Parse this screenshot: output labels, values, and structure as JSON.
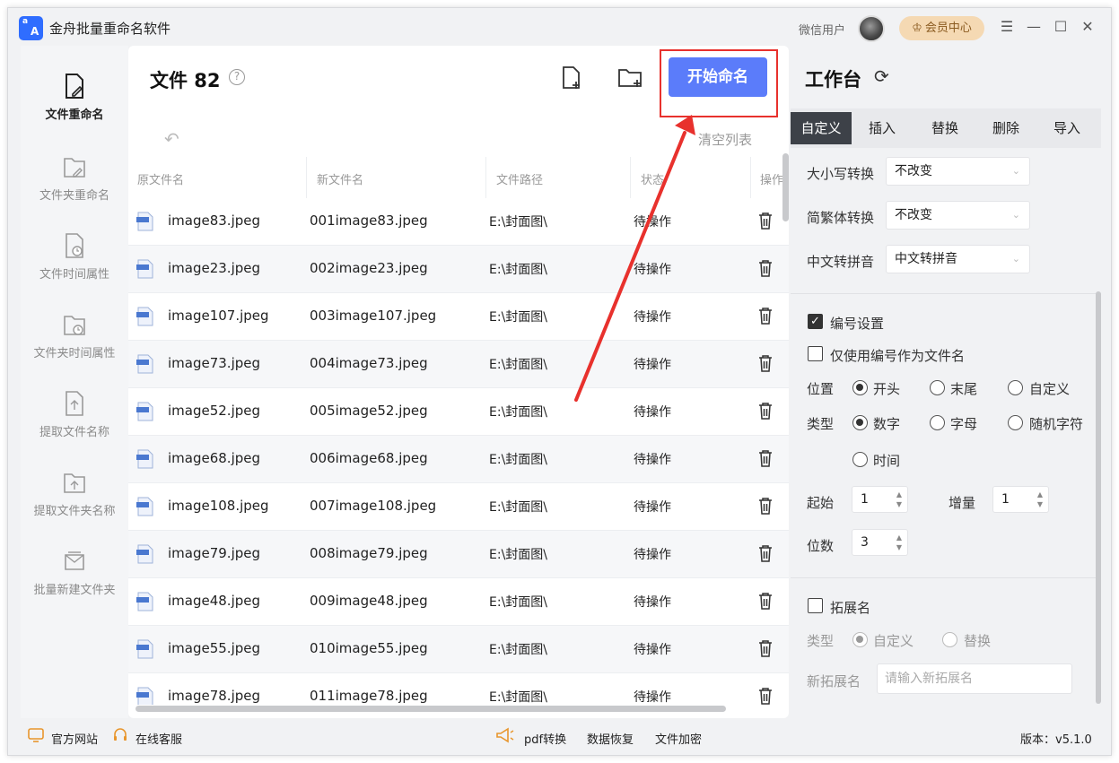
{
  "app": {
    "title": "金舟批量重命名软件",
    "user": "微信用户",
    "vip_label": "会员中心",
    "controls": [
      "minimize",
      "maximize",
      "close",
      "menu"
    ]
  },
  "nav": {
    "items": [
      {
        "label": "文件重命名",
        "icon": "file-edit-icon",
        "active": true
      },
      {
        "label": "文件夹重命名",
        "icon": "folder-edit-icon",
        "active": false
      },
      {
        "label": "文件时间属性",
        "icon": "file-clock-icon",
        "active": false
      },
      {
        "label": "文件夹时间属性",
        "icon": "folder-clock-icon",
        "active": false
      },
      {
        "label": "提取文件名称",
        "icon": "file-extract-icon",
        "active": false
      },
      {
        "label": "提取文件夹名称",
        "icon": "folder-extract-icon",
        "active": false
      },
      {
        "label": "批量新建文件夹",
        "icon": "mail-folder-icon",
        "active": false
      }
    ]
  },
  "center": {
    "files_label": "文件 82",
    "start_button": "开始命名",
    "clear_list": "清空列表",
    "columns": [
      "原文件名",
      "新文件名",
      "文件路径",
      "状态",
      "操作"
    ],
    "rows": [
      {
        "original": "image83.jpeg",
        "new": "001image83.jpeg",
        "path": "E:\\封面图\\",
        "status": "待操作"
      },
      {
        "original": "image23.jpeg",
        "new": "002image23.jpeg",
        "path": "E:\\封面图\\",
        "status": "待操作"
      },
      {
        "original": "image107.jpeg",
        "new": "003image107.jpeg",
        "path": "E:\\封面图\\",
        "status": "待操作"
      },
      {
        "original": "image73.jpeg",
        "new": "004image73.jpeg",
        "path": "E:\\封面图\\",
        "status": "待操作"
      },
      {
        "original": "image52.jpeg",
        "new": "005image52.jpeg",
        "path": "E:\\封面图\\",
        "status": "待操作"
      },
      {
        "original": "image68.jpeg",
        "new": "006image68.jpeg",
        "path": "E:\\封面图\\",
        "status": "待操作"
      },
      {
        "original": "image108.jpeg",
        "new": "007image108.jpeg",
        "path": "E:\\封面图\\",
        "status": "待操作"
      },
      {
        "original": "image79.jpeg",
        "new": "008image79.jpeg",
        "path": "E:\\封面图\\",
        "status": "待操作"
      },
      {
        "original": "image48.jpeg",
        "new": "009image48.jpeg",
        "path": "E:\\封面图\\",
        "status": "待操作"
      },
      {
        "original": "image55.jpeg",
        "new": "010image55.jpeg",
        "path": "E:\\封面图\\",
        "status": "待操作"
      },
      {
        "original": "image78.jpeg",
        "new": "011image78.jpeg",
        "path": "E:\\封面图\\",
        "status": "待操作"
      }
    ],
    "file_icon_label": "JPEG"
  },
  "workbench": {
    "title": "工作台",
    "tabs": [
      "自定义",
      "插入",
      "替换",
      "删除",
      "导入"
    ],
    "active_tab": "自定义",
    "case_label": "大小写转换",
    "case_value": "不改变",
    "trad_label": "简繁体转换",
    "trad_value": "不改变",
    "pinyin_label": "中文转拼音",
    "pinyin_value": "中文转拼音",
    "numbering_label": "编号设置",
    "numbering_checked": true,
    "only_number_label": "仅使用编号作为文件名",
    "only_number_checked": false,
    "position_label": "位置",
    "position_options": [
      "开头",
      "末尾",
      "自定义"
    ],
    "position_selected": "开头",
    "type_label": "类型",
    "type_options": [
      "数字",
      "字母",
      "随机字符",
      "时间"
    ],
    "type_selected": "数字",
    "start_label": "起始",
    "start_value": "1",
    "step_label": "增量",
    "step_value": "1",
    "digits_label": "位数",
    "digits_value": "3",
    "ext_label": "拓展名",
    "ext_checked": false,
    "ext_type_label": "类型",
    "ext_type_options": [
      "自定义",
      "替换"
    ],
    "ext_type_selected": "自定义",
    "new_ext_label": "新拓展名",
    "new_ext_placeholder": "请输入新拓展名"
  },
  "footer": {
    "website": "官方网站",
    "service": "在线客服",
    "pdf": "pdf转换",
    "recovery": "数据恢复",
    "encrypt": "文件加密",
    "version": "版本：v5.1.0"
  },
  "colors": {
    "accent": "#5b7cfa",
    "highlight": "#e8312d",
    "tab_active": "#3d4148",
    "vip_bg": "#f5d9b3"
  }
}
